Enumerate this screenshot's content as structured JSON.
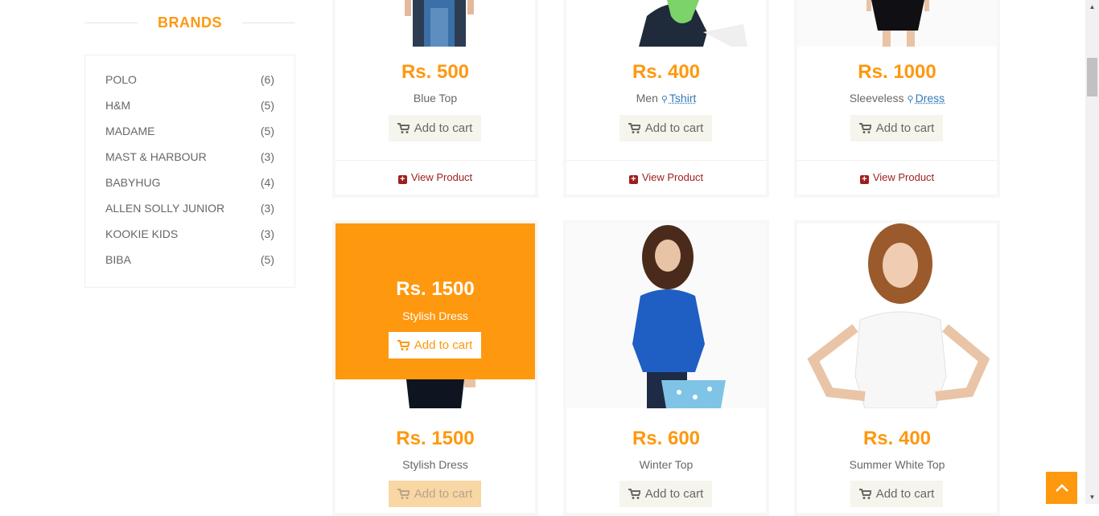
{
  "sidebar": {
    "title": "BRANDS",
    "brands": [
      {
        "name": "POLO",
        "count": "(6)"
      },
      {
        "name": "H&M",
        "count": "(5)"
      },
      {
        "name": "MADAME",
        "count": "(5)"
      },
      {
        "name": "MAST & HARBOUR",
        "count": "(3)"
      },
      {
        "name": "BABYHUG",
        "count": "(4)"
      },
      {
        "name": "ALLEN SOLLY JUNIOR",
        "count": "(3)"
      },
      {
        "name": "KOOKIE KIDS",
        "count": "(3)"
      },
      {
        "name": "BIBA",
        "count": "(5)"
      }
    ]
  },
  "products_row1": [
    {
      "price": "Rs. 500",
      "name": "Blue Top",
      "add_to_cart": "Add to cart",
      "view_product": "View Product"
    },
    {
      "price": "Rs. 400",
      "name": "Men",
      "tag": "Tshirt",
      "add_to_cart": "Add to cart",
      "view_product": "View Product"
    },
    {
      "price": "Rs. 1000",
      "name": "Sleeveless",
      "tag": "Dress",
      "add_to_cart": "Add to cart",
      "view_product": "View Product"
    }
  ],
  "products_row2": [
    {
      "price": "Rs. 1500",
      "name": "Stylish Dress",
      "add_to_cart": "Add to cart",
      "overlay": {
        "price": "Rs. 1500",
        "name": "Stylish Dress",
        "add_to_cart": "Add to cart"
      }
    },
    {
      "price": "Rs. 600",
      "name": "Winter Top",
      "add_to_cart": "Add to cart"
    },
    {
      "price": "Rs. 400",
      "name": "Summer White Top",
      "add_to_cart": "Add to cart"
    }
  ],
  "colors": {
    "accent": "#fe980f",
    "view_product": "#9d1f1f",
    "link": "#337ab7",
    "button_bg": "#f5f5ed"
  }
}
